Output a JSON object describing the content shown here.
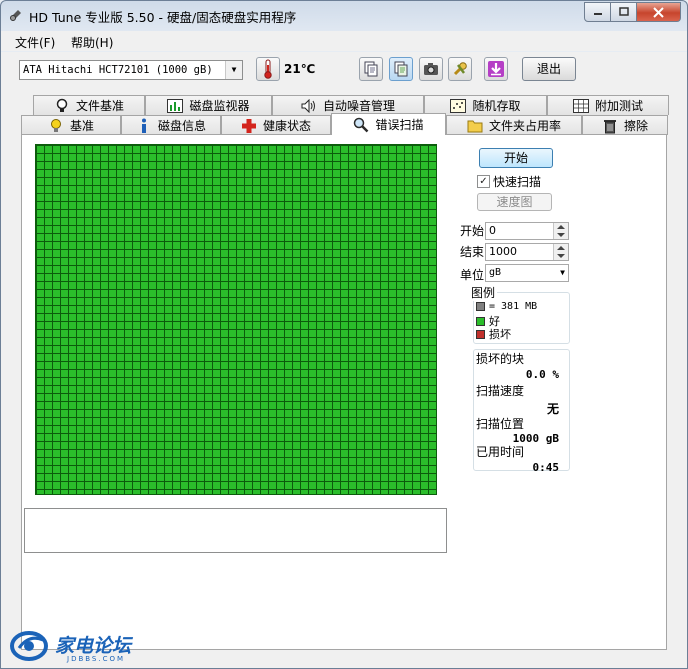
{
  "window": {
    "title": "HD Tune 专业版 5.50 - 硬盘/固态硬盘实用程序"
  },
  "menu": {
    "file": "文件(F)",
    "help": "帮助(H)"
  },
  "toolbar": {
    "drive": "ATA    Hitachi HCT72101 (1000 gB)",
    "temperature": "21℃",
    "exit_label": "退出"
  },
  "tabs_top": [
    "文件基准",
    "磁盘监视器",
    "自动噪音管理",
    "随机存取",
    "附加测试"
  ],
  "tabs_bottom": [
    "基准",
    "磁盘信息",
    "健康状态",
    "错误扫描",
    "文件夹占用率",
    "擦除"
  ],
  "scan": {
    "start_label": "开始",
    "quick_scan_label": "快速扫描",
    "quick_scan_checked": true,
    "speed_map_label": "速度图",
    "start_field_label": "开始",
    "start_value": "0",
    "end_field_label": "结束",
    "end_value": "1000",
    "unit_label": "单位",
    "unit_value": "gB"
  },
  "legend": {
    "title": "图例",
    "block_size": "= 381 MB",
    "good_label": "好",
    "bad_label": "损坏",
    "colors": {
      "block": "#808080",
      "good": "#2bbe2b",
      "bad": "#c0302c"
    }
  },
  "stats": {
    "damaged_blocks_label": "损坏的块",
    "damaged_blocks_value": "0.0 %",
    "scan_speed_label": "扫描速度",
    "scan_speed_value": "无",
    "scan_position_label": "扫描位置",
    "scan_position_value": "1000 gB",
    "elapsed_label": "已用时间",
    "elapsed_value": "0:45"
  },
  "watermark": {
    "text": "家电论坛",
    "subtext": "JDBBS.COM"
  }
}
